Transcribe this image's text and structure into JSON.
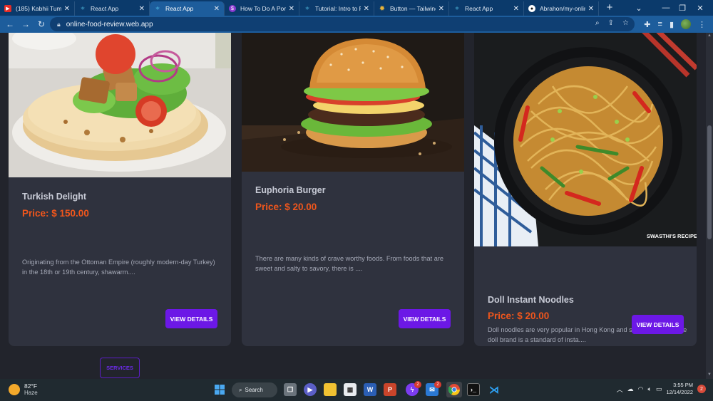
{
  "browser": {
    "tabs": [
      {
        "title": "(185) Kabhii Tumh",
        "icon": "youtube-icon",
        "color": "#e52d27"
      },
      {
        "title": "React App",
        "icon": "react-icon",
        "color": "#0b3a6b"
      },
      {
        "title": "React App",
        "icon": "react-icon",
        "color": "#1d5d9c"
      },
      {
        "title": "How To Do A Por",
        "icon": "dollar-icon",
        "color": "#8a3ad1"
      },
      {
        "title": "Tutorial: Intro to R",
        "icon": "react-icon",
        "color": "#0b3a6b"
      },
      {
        "title": "Button — Tailwind",
        "icon": "sun-icon",
        "color": "#e8b43a"
      },
      {
        "title": "React App",
        "icon": "react-icon",
        "color": "#0b3a6b"
      },
      {
        "title": "Abrahon/my-onlin",
        "icon": "github-icon",
        "color": "#111111"
      }
    ],
    "url": "online-food-review.web.app"
  },
  "cards": [
    {
      "title": "Turkish Delight",
      "price": "Price: $ 150.00",
      "description": "Originating from the Ottoman Empire (roughly modern-day Turkey) in the 18th or 19th century, shawarm....",
      "button": "VIEW DETAILS"
    },
    {
      "title": "Euphoria Burger",
      "price": "Price: $ 20.00",
      "description": "There are many kinds of crave worthy foods. From foods that are sweet and salty to savory, there is ....",
      "button": "VIEW DETAILS"
    },
    {
      "title": "Doll Instant Noodles",
      "price": "Price: $ 20.00",
      "description": "Doll noodles are very popular in Hong Kong and southern china. The doll brand is a standard of insta....",
      "button": "VIEW DETAILS",
      "image_watermark": "SWASTHI'S RECIPES"
    }
  ],
  "services_button": "SERVICES",
  "taskbar": {
    "weather_temp": "82°F",
    "weather_desc": "Haze",
    "search_label": "Search",
    "messenger_badge": "2",
    "mail_badge": "2",
    "time": "3:55 PM",
    "date": "12/14/2022",
    "notification_count": "2"
  },
  "colors": {
    "accent": "#6c18e6",
    "price": "#f0561c",
    "card_bg": "#2f323e",
    "page_bg": "#22242c"
  }
}
